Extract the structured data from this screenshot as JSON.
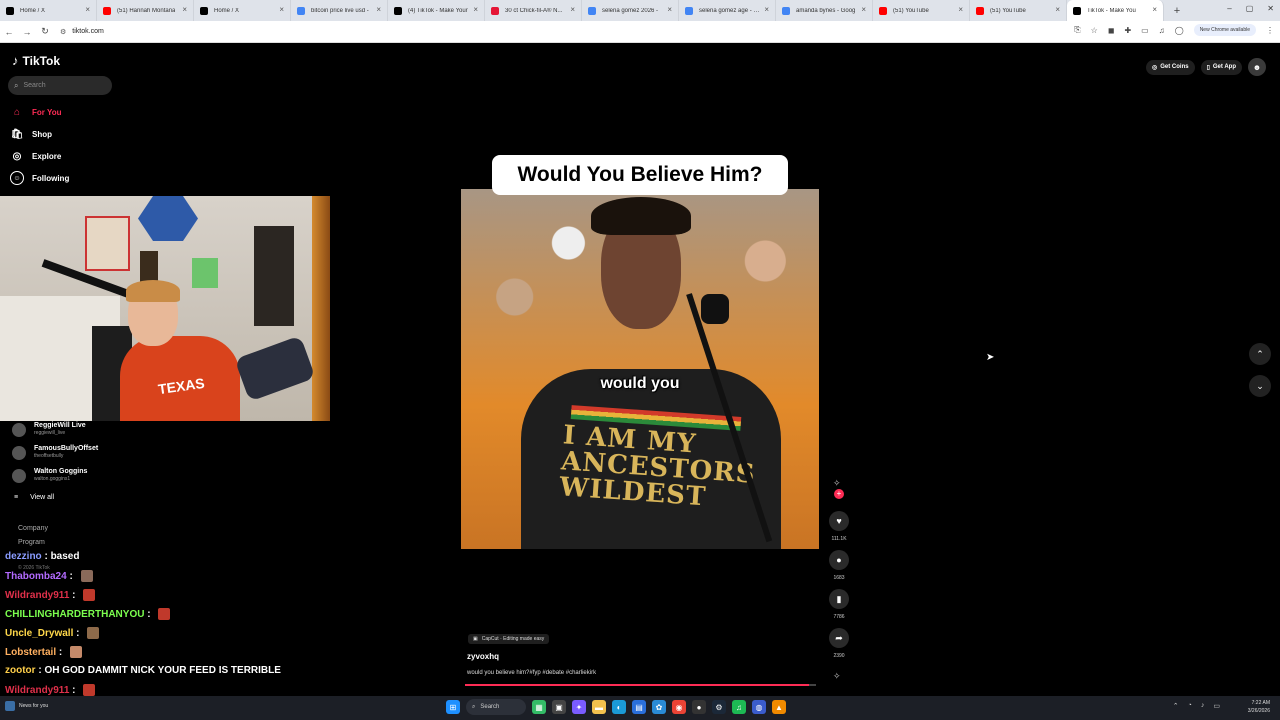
{
  "browser": {
    "tabs": [
      {
        "title": "Home / X",
        "color": "#000000"
      },
      {
        "title": "(51) Hannah Montana",
        "color": "#ff0000"
      },
      {
        "title": "Home / X",
        "color": "#000000"
      },
      {
        "title": "bitcoin price live usd -",
        "color": "#4285f4"
      },
      {
        "title": "(4) TikTok - Make Your",
        "color": "#000000"
      },
      {
        "title": "30 ct Chick-fil-A® N...",
        "color": "#e51636"
      },
      {
        "title": "selena gomez 2026 -",
        "color": "#4285f4"
      },
      {
        "title": "selena gomez age - Go",
        "color": "#4285f4"
      },
      {
        "title": "amanda bynes - Goog",
        "color": "#4285f4"
      },
      {
        "title": "(51) YouTube",
        "color": "#ff0000"
      },
      {
        "title": "(51) YouTube",
        "color": "#ff0000"
      },
      {
        "title": "TikTok - Make You",
        "color": "#000000"
      }
    ],
    "url": "tiktok.com",
    "update_label": "New Chrome available"
  },
  "tiktok": {
    "logo": "TikTok",
    "search_placeholder": "Search",
    "nav": [
      {
        "label": "For You",
        "icon": "home-icon",
        "active": true
      },
      {
        "label": "Shop",
        "icon": "shop-icon",
        "active": false
      },
      {
        "label": "Explore",
        "icon": "compass-icon",
        "active": false
      },
      {
        "label": "Following",
        "icon": "following-icon",
        "active": false
      }
    ],
    "following_accounts": [
      {
        "name": "ReggieWill Live",
        "handle": "reggiewill_live"
      },
      {
        "name": "FamousBullyOffset",
        "handle": "theoffsetbully"
      },
      {
        "name": "Walton Goggins",
        "handle": "walton.goggins1"
      }
    ],
    "view_all": "View all",
    "footer_links": [
      "Company",
      "Program"
    ],
    "copyright": "© 2026 TikTok",
    "get_coins": "Get Coins",
    "get_app": "Get App",
    "video": {
      "title_card": "Would You Believe Him?",
      "caption_word": "would you",
      "shirt_text": "I AM MY\nANCESTORS\nWILDEST",
      "capcut_label": "CapCut · Editing made easy",
      "author": "zyvoxhq",
      "description": "would you believe him?#fyp #debate #charliekirk",
      "progress_pct": 98
    },
    "actions": {
      "likes": "111.1K",
      "comments": "1683",
      "saves": "7786",
      "shares": "2390"
    }
  },
  "chat": [
    {
      "user": "dezzino",
      "color": "#8a9cff",
      "msg": "based",
      "emote": ""
    },
    {
      "user": "Thabomba24",
      "color": "#b36bff",
      "msg": "",
      "emote": "#8a6a5a"
    },
    {
      "user": "Wildrandy911",
      "color": "#e0304a",
      "msg": "",
      "emote": "#c0392b"
    },
    {
      "user": "CHILLINGHARDERTHANYOU",
      "color": "#7cff4f",
      "msg": "",
      "emote": "#c0392b"
    },
    {
      "user": "Uncle_Drywall",
      "color": "#ffd84a",
      "msg": "",
      "emote": "#8e6a4a"
    },
    {
      "user": "Lobstertail",
      "color": "#ffb060",
      "msg": "",
      "emote": "#c58a6a"
    },
    {
      "user": "zootor",
      "color": "#ffcf4a",
      "msg": "OH GOD DAMMIT NICK YOUR FEED IS TERRIBLE",
      "emote": ""
    },
    {
      "user": "Wildrandy911",
      "color": "#e0304a",
      "msg": "",
      "emote": "#c0392b"
    }
  ],
  "taskbar": {
    "widget": "News for you",
    "search": "Search",
    "time": "7:22 AM",
    "date": "3/26/2026"
  }
}
